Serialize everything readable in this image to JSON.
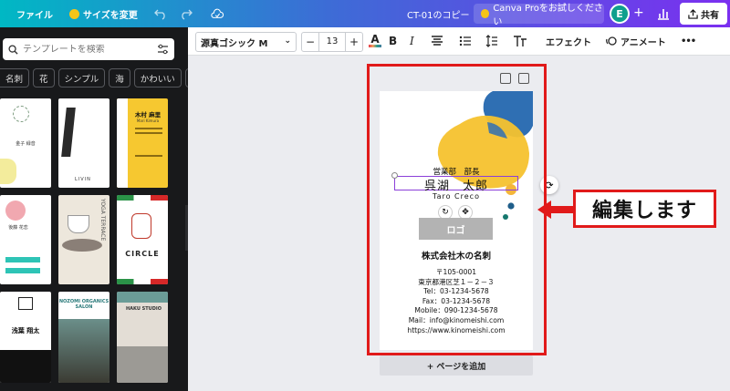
{
  "topbar": {
    "file_label": "ファイル",
    "resize_label": "サイズを変更",
    "doc_title": "CT-01のコピー",
    "pro_label": "Canva Proをお試しください",
    "avatar_letter": "E",
    "share_label": "共有"
  },
  "sidebar": {
    "search_placeholder": "テンプレートを検索",
    "chips": [
      "名刺",
      "花",
      "シンプル",
      "海",
      "かわいい",
      "ア"
    ],
    "templates": [
      {
        "name": "金子 緑音"
      },
      {
        "name": "LIVIN"
      },
      {
        "name": "木村 麻里",
        "subtitle": "Mari Kimura"
      },
      {
        "name": "後藤 花恋"
      },
      {
        "name": "YOGA TERRACE"
      },
      {
        "name": "CIRCLE"
      },
      {
        "name": "浅葉 翔太"
      },
      {
        "name": "NOZOMI ORGANICS SALON"
      },
      {
        "name": "HAKU STUDIO"
      }
    ]
  },
  "toolbar": {
    "font": "源真ゴシック M",
    "size_minus": "−",
    "size_value": "13",
    "size_plus": "+",
    "bold": "B",
    "italic": "I",
    "effects": "エフェクト",
    "animate": "アニメート",
    "more": "•••"
  },
  "card": {
    "position_title": "営業部　部長",
    "name": "呉湖　太郎",
    "romaji": "Taro Creco",
    "logo": "ロゴ",
    "company": "株式会社木の名刺",
    "address_lines": [
      "〒105-0001",
      "東京都港区芝１－２－３",
      "Tel：03-1234-5678",
      "Fax：03-1234-5678",
      "Mobile：090-1234-5678",
      "Mail：info@kinomeishi.com",
      "https://www.kinomeishi.com"
    ]
  },
  "add_page": "+ ページを追加",
  "callout": "編集します"
}
